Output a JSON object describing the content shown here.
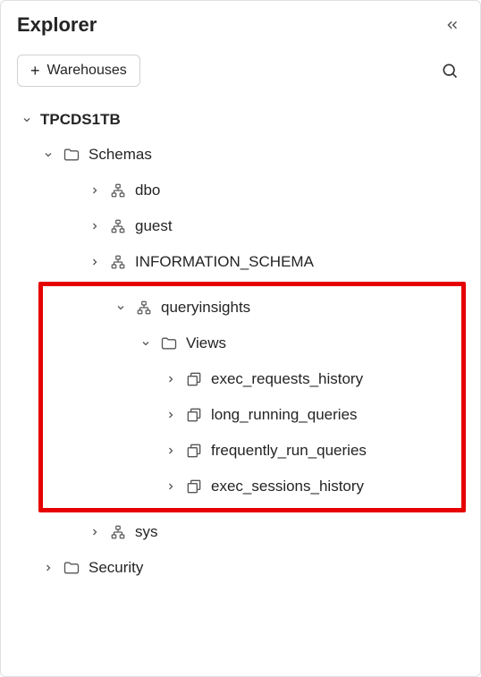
{
  "header": {
    "title": "Explorer"
  },
  "toolbar": {
    "add_label": "Warehouses"
  },
  "tree": {
    "database": "TPCDS1TB",
    "schemas_label": "Schemas",
    "schemas": {
      "dbo": "dbo",
      "guest": "guest",
      "information_schema": "INFORMATION_SCHEMA",
      "queryinsights": "queryinsights",
      "sys": "sys"
    },
    "views_label": "Views",
    "views": {
      "exec_requests_history": "exec_requests_history",
      "long_running_queries": "long_running_queries",
      "frequently_run_queries": "frequently_run_queries",
      "exec_sessions_history": "exec_sessions_history"
    },
    "security_label": "Security"
  }
}
